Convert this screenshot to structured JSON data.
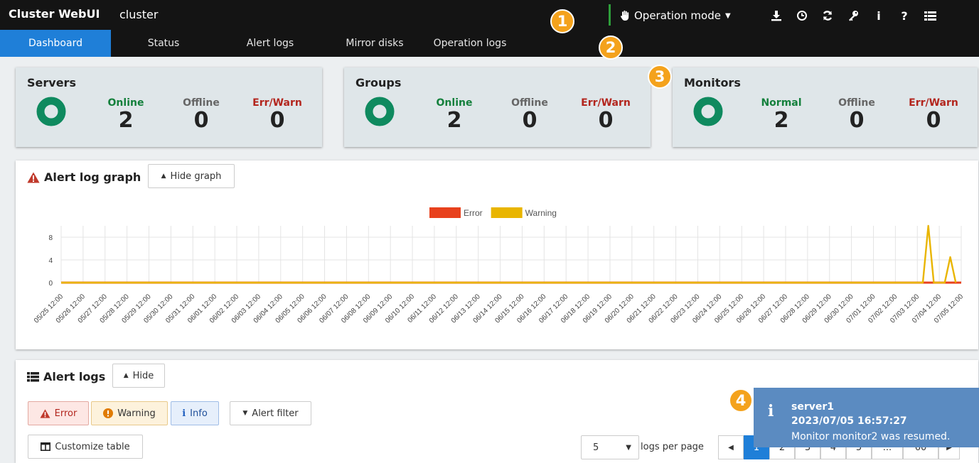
{
  "header": {
    "brand": "Cluster WebUI",
    "cluster_name": "cluster",
    "operation_mode": "Operation mode",
    "toolbar_icons": [
      "download-icon",
      "clock-icon",
      "refresh-icon",
      "key-icon",
      "info-icon",
      "help-icon",
      "menu-icon"
    ]
  },
  "tabs": [
    {
      "label": "Dashboard",
      "active": true
    },
    {
      "label": "Status"
    },
    {
      "label": "Alert logs"
    },
    {
      "label": "Mirror disks"
    },
    {
      "label": "Operation logs"
    }
  ],
  "callouts": [
    "1",
    "2",
    "3",
    "4"
  ],
  "cards": {
    "servers": {
      "title": "Servers",
      "labels": [
        "Online",
        "Offline",
        "Err/Warn"
      ],
      "values": [
        "2",
        "0",
        "0"
      ]
    },
    "groups": {
      "title": "Groups",
      "labels": [
        "Online",
        "Offline",
        "Err/Warn"
      ],
      "values": [
        "2",
        "0",
        "0"
      ]
    },
    "monitors": {
      "title": "Monitors",
      "labels": [
        "Normal",
        "Offline",
        "Err/Warn"
      ],
      "values": [
        "2",
        "0",
        "0"
      ]
    }
  },
  "alert_graph": {
    "title": "Alert log graph",
    "hide_button": "Hide graph"
  },
  "chart_data": {
    "type": "line",
    "x": [
      "05/25 12:00",
      "05/26 12:00",
      "05/27 12:00",
      "05/28 12:00",
      "05/29 12:00",
      "05/30 12:00",
      "05/31 12:00",
      "06/01 12:00",
      "06/02 12:00",
      "06/03 12:00",
      "06/04 12:00",
      "06/05 12:00",
      "06/06 12:00",
      "06/07 12:00",
      "06/08 12:00",
      "06/09 12:00",
      "06/10 12:00",
      "06/11 12:00",
      "06/12 12:00",
      "06/13 12:00",
      "06/14 12:00",
      "06/15 12:00",
      "06/16 12:00",
      "06/17 12:00",
      "06/18 12:00",
      "06/19 12:00",
      "06/20 12:00",
      "06/21 12:00",
      "06/22 12:00",
      "06/23 12:00",
      "06/24 12:00",
      "06/25 12:00",
      "06/26 12:00",
      "06/27 12:00",
      "06/28 12:00",
      "06/29 12:00",
      "06/30 12:00",
      "07/01 12:00",
      "07/02 12:00",
      "07/03 12:00",
      "07/04 12:00",
      "07/05 12:00"
    ],
    "yticks": [
      "0",
      "4",
      "8"
    ],
    "ylim": [
      0,
      10
    ],
    "grid": true,
    "legend_position": "top-center",
    "series": [
      {
        "name": "Error",
        "color": "#e8411d",
        "points": [
          [
            "05/25 12:00",
            0
          ],
          [
            "07/05 12:00",
            0
          ]
        ]
      },
      {
        "name": "Warning",
        "color": "#e9b500",
        "points": [
          [
            "05/25 12:00",
            0
          ],
          [
            "07/03 12:00",
            0
          ],
          [
            "07/03 18:00",
            0
          ],
          [
            "07/04 00:00",
            10
          ],
          [
            "07/04 06:00",
            0
          ],
          [
            "07/04 18:00",
            0
          ],
          [
            "07/05 00:00",
            4.5
          ],
          [
            "07/05 06:00",
            0
          ]
        ]
      }
    ]
  },
  "alert_logs": {
    "title": "Alert logs",
    "hide_button": "Hide",
    "filters": {
      "error": "Error",
      "warning": "Warning",
      "info": "Info"
    },
    "alert_filter": "Alert filter",
    "customize": "Customize table",
    "per_page_value": "5",
    "per_page_label": "logs per page",
    "pages": [
      "1",
      "2",
      "3",
      "4",
      "5",
      "...",
      "60"
    ]
  },
  "toast": {
    "server": "server1",
    "time": "2023/07/05 16:57:27",
    "message": "Monitor monitor2 was resumed."
  }
}
